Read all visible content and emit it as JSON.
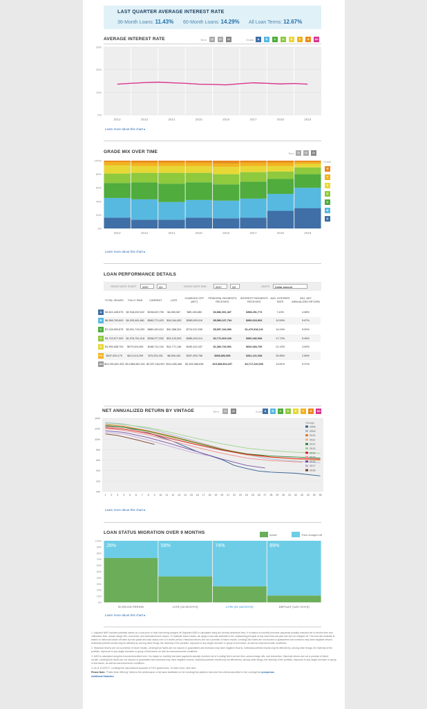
{
  "summary": {
    "title": "LAST QUARTER AVERAGE INTEREST RATE",
    "items": [
      {
        "label": "36-Month Loans:",
        "value": "11.43%"
      },
      {
        "label": "60-Month Loans:",
        "value": "14.29%"
      },
      {
        "label": "All Loan Terms:",
        "value": "12.67%"
      }
    ]
  },
  "links": {
    "learn_more": "Learn more about this chart ▸"
  },
  "controls": {
    "term_label": "Term",
    "grade_label": "Grade",
    "term_buttons": [
      "36",
      "60",
      "All"
    ],
    "term_buttons_short": [
      "36",
      "All"
    ]
  },
  "grades": [
    {
      "g": "A",
      "color": "#3f6fa6"
    },
    {
      "g": "B",
      "color": "#57b9e0"
    },
    {
      "g": "C",
      "color": "#4fac3d"
    },
    {
      "g": "D",
      "color": "#8fc93d"
    },
    {
      "g": "E",
      "color": "#e8d835"
    },
    {
      "g": "F",
      "color": "#f2b21f"
    },
    {
      "g": "G",
      "color": "#e88a1e"
    },
    {
      "g": "All",
      "color": "#d8358f"
    }
  ],
  "chart_data": [
    {
      "id": "avg_rate",
      "title": "AVERAGE INTEREST RATE",
      "type": "line",
      "x": [
        2012,
        2012.5,
        2013,
        2013.5,
        2014,
        2014.5,
        2015,
        2015.5,
        2016,
        2016.5,
        2017,
        2017.5,
        2018,
        2018.5,
        2019
      ],
      "y": [
        13.6,
        14.0,
        14.3,
        14.5,
        14.2,
        14.0,
        13.6,
        13.5,
        13.3,
        13.8,
        14.2,
        14.0,
        13.7,
        13.9,
        13.6
      ],
      "ylim": [
        0,
        30
      ],
      "yticks": [
        "0%",
        "10%",
        "20%",
        "30%"
      ],
      "xticks": [
        "2012",
        "2013",
        "2014",
        "2015",
        "2016",
        "2017",
        "2018",
        "2019"
      ],
      "color": "#d8358f"
    },
    {
      "id": "grade_mix",
      "title": "GRADE MIX OVER TIME",
      "type": "bar",
      "categories": [
        "2012",
        "2013",
        "2014",
        "2015",
        "2016",
        "2017",
        "2018",
        "2019"
      ],
      "yticks": [
        "0%",
        "20%",
        "40%",
        "60%",
        "80%",
        "100%"
      ],
      "stack_order": [
        "A",
        "B",
        "C",
        "D",
        "E",
        "F",
        "G"
      ],
      "values": [
        [
          16,
          13,
          13,
          16,
          15,
          16,
          26,
          30
        ],
        [
          29,
          30,
          26,
          26,
          26,
          28,
          25,
          30
        ],
        [
          22,
          25,
          27,
          26,
          24,
          25,
          22,
          20
        ],
        [
          14,
          14,
          16,
          14,
          15,
          14,
          11,
          10
        ],
        [
          12,
          10,
          10,
          10,
          11,
          9,
          8,
          5
        ],
        [
          5,
          5,
          5,
          5,
          5,
          5,
          5,
          3
        ],
        [
          2,
          3,
          3,
          3,
          4,
          3,
          3,
          2
        ]
      ]
    },
    {
      "id": "net_return",
      "title": "NET ANNUALIZED RETURN BY VINTAGE",
      "type": "line",
      "ylim": [
        0,
        14
      ],
      "yticks": [
        "0%",
        "2%",
        "4%",
        "6%",
        "8%",
        "10%",
        "12%",
        "14%"
      ],
      "xticks": [
        "1",
        "2",
        "3",
        "4",
        "5",
        "6",
        "7",
        "8",
        "9",
        "10",
        "11",
        "12",
        "13",
        "14",
        "15",
        "16",
        "17",
        "18",
        "19",
        "20",
        "21",
        "22",
        "23",
        "24",
        "25",
        "26",
        "27",
        "28",
        "29",
        "30",
        "31",
        "32",
        "33",
        "34",
        "35",
        "36"
      ],
      "legend_title": "Vintage",
      "series": [
        {
          "name": "2008",
          "color": "#2f5f8f",
          "points": [
            [
              1,
              12.5
            ],
            [
              4,
              12.3
            ],
            [
              8,
              11.2
            ],
            [
              12,
              9.6
            ],
            [
              16,
              7.6
            ],
            [
              20,
              6.1
            ],
            [
              22,
              5.0
            ],
            [
              24,
              4.4
            ],
            [
              26,
              3.9
            ],
            [
              28,
              3.7
            ],
            [
              32,
              3.5
            ],
            [
              36,
              3.0
            ]
          ]
        },
        {
          "name": "2009",
          "color": "#aab8d2",
          "points": [
            [
              1,
              13.2
            ],
            [
              4,
              12.9
            ],
            [
              8,
              12.0
            ],
            [
              12,
              10.8
            ],
            [
              16,
              9.5
            ],
            [
              20,
              8.2
            ],
            [
              24,
              7.0
            ],
            [
              28,
              6.2
            ],
            [
              32,
              5.8
            ],
            [
              36,
              5.5
            ]
          ]
        },
        {
          "name": "2010",
          "color": "#e8741e",
          "points": [
            [
              1,
              12.8
            ],
            [
              4,
              12.5
            ],
            [
              8,
              11.6
            ],
            [
              12,
              10.5
            ],
            [
              16,
              9.3
            ],
            [
              20,
              8.1
            ],
            [
              24,
              7.2
            ],
            [
              28,
              6.6
            ],
            [
              32,
              6.2
            ],
            [
              36,
              6.0
            ]
          ]
        },
        {
          "name": "2011",
          "color": "#f4b183",
          "points": [
            [
              1,
              12.4
            ],
            [
              4,
              12.1
            ],
            [
              8,
              11.3
            ],
            [
              12,
              10.2
            ],
            [
              16,
              9.0
            ],
            [
              20,
              7.9
            ],
            [
              24,
              7.0
            ],
            [
              28,
              6.5
            ],
            [
              32,
              6.2
            ],
            [
              36,
              6.1
            ]
          ]
        },
        {
          "name": "2012",
          "color": "#2e8b2e",
          "points": [
            [
              1,
              12.6
            ],
            [
              4,
              12.3
            ],
            [
              8,
              11.5
            ],
            [
              12,
              10.4
            ],
            [
              16,
              9.2
            ],
            [
              20,
              8.0
            ],
            [
              24,
              7.2
            ],
            [
              28,
              6.8
            ],
            [
              32,
              6.6
            ],
            [
              36,
              6.4
            ]
          ]
        },
        {
          "name": "2013",
          "color": "#9bd48a",
          "points": [
            [
              1,
              13.0
            ],
            [
              4,
              12.8
            ],
            [
              8,
              12.2
            ],
            [
              12,
              11.2
            ],
            [
              16,
              10.1
            ],
            [
              20,
              9.1
            ],
            [
              24,
              8.3
            ],
            [
              28,
              7.8
            ],
            [
              32,
              7.5
            ],
            [
              36,
              7.3
            ]
          ]
        },
        {
          "name": "2014",
          "color": "#d8222a",
          "points": [
            [
              1,
              12.2
            ],
            [
              4,
              11.9
            ],
            [
              8,
              11.1
            ],
            [
              12,
              10.0
            ],
            [
              16,
              8.9
            ],
            [
              20,
              7.9
            ],
            [
              24,
              7.1
            ],
            [
              28,
              6.6
            ],
            [
              32,
              6.3
            ],
            [
              36,
              6.2
            ]
          ]
        },
        {
          "name": "2015",
          "color": "#f28b8b",
          "points": [
            [
              1,
              12.0
            ],
            [
              4,
              11.7
            ],
            [
              8,
              10.8
            ],
            [
              12,
              9.6
            ],
            [
              16,
              8.4
            ],
            [
              20,
              7.3
            ],
            [
              24,
              6.4
            ],
            [
              28,
              5.9
            ],
            [
              33,
              5.6
            ]
          ]
        },
        {
          "name": "2016",
          "color": "#7a4fa8",
          "points": [
            [
              1,
              11.6
            ],
            [
              4,
              11.3
            ],
            [
              8,
              10.3
            ],
            [
              12,
              9.0
            ],
            [
              16,
              7.6
            ],
            [
              20,
              6.2
            ],
            [
              24,
              5.0
            ],
            [
              27,
              4.5
            ]
          ]
        },
        {
          "name": "2017",
          "color": "#c3a8d8",
          "points": [
            [
              1,
              11.3
            ],
            [
              4,
              11.0
            ],
            [
              8,
              9.8
            ],
            [
              12,
              8.5
            ],
            [
              15,
              7.5
            ],
            [
              18,
              6.8
            ]
          ]
        },
        {
          "name": "2018",
          "color": "#7a3b23",
          "points": [
            [
              1,
              11.0
            ],
            [
              3,
              10.7
            ],
            [
              6,
              9.9
            ],
            [
              9,
              9.0
            ]
          ]
        }
      ]
    },
    {
      "id": "status_migration",
      "title": "LOAN STATUS MIGRATION OVER 9 MONTHS",
      "type": "bar",
      "categories": [
        "IN GRACE PERIOD",
        "LATE (16-30 DAYS)",
        "LATE (31-120 DAYS)",
        "DEFAULT (120+ DAYS)"
      ],
      "yticks": [
        "0%",
        "10%",
        "20%",
        "30%",
        "40%",
        "50%",
        "60%",
        "70%",
        "80%",
        "90%",
        "100%"
      ],
      "series": [
        {
          "name": "Active",
          "color": "#6cad5a",
          "values": [
            72,
            42,
            26,
            11
          ]
        },
        {
          "name": "Then charged off",
          "color": "#6dcde6",
          "values": [
            28,
            58,
            74,
            89
          ]
        }
      ],
      "labels": [
        "28%",
        "58%",
        "74%",
        "89%"
      ]
    }
  ],
  "perf": {
    "title": "LOAN PERFORMANCE DETAILS",
    "filters": {
      "start_label": "ISSUE DATE START",
      "start_year": "2007",
      "start_q": "Q1",
      "end_label": "ISSUE DATE END",
      "end_year": "2017",
      "end_q": "Q2",
      "units_label": "UNITS",
      "units": "Dollar amount"
    },
    "headers": [
      "",
      "TOTAL ISSUED",
      "FULLY PAID",
      "CURRENT",
      "LATE",
      "CHARGED OFF (NET)",
      "PRINCIPAL PAYMENTS RECEIVED",
      "INTEREST PAYMENTS RECEIVED",
      "AVG. INTEREST RATE",
      "ADJ. NET ANNUALIZED RETURN"
    ],
    "rows": [
      [
        "A",
        "$3,624,185,575",
        "$2,918,492,922",
        "$238,629,759",
        "$4,069,367",
        "$89,135,880",
        "$3,580,391,367",
        "$358,251,773",
        "7.10%",
        "4.58%"
      ],
      [
        "B",
        "$6,558,763,600",
        "$4,293,461,861",
        "$583,771,623",
        "$18,164,453",
        "$365,699,116",
        "$5,589,137,794",
        "$969,010,563",
        "10.59%",
        "5.67%"
      ],
      [
        "C",
        "$7,218,893,875",
        "$3,991,716,093",
        "$882,440,612",
        "$42,388,324",
        "$724,912,935",
        "$5,557,154,966",
        "$1,470,918,131",
        "14.04%",
        "5.92%"
      ],
      [
        "D",
        "$3,719,577,000",
        "$1,976,751,218",
        "$338,377,532",
        "$23,120,093",
        "$585,493,214",
        "$2,772,609,160",
        "$960,282,908",
        "17.73%",
        "5.45%"
      ],
      [
        "E",
        "$1,995,638,700",
        "$979,024,349",
        "$168,711,134",
        "$14,771,136",
        "$430,422,437",
        "$1,383,733,991",
        "$626,684,759",
        "21.15%",
        "4.90%"
      ],
      [
        "FG",
        "$937,533,175",
        "$413,115,299",
        "$75,225,331",
        "$8,906,183",
        "$267,459,756",
        "$585,896,985",
        "$331,221,938",
        "25.86%",
        "2.89%"
      ],
      [
        "All",
        "$24,250,691,325",
        "$14,565,562,341",
        "$2,287,164,991",
        "$111,456,466",
        "$2,463,086,638",
        "$19,388,804,297",
        "$4,717,220,695",
        "13.61%",
        "5.37%"
      ]
    ]
  },
  "migration_legend": [
    "Active",
    "Then charged off"
  ],
  "footnotes": [
    "1. Adjusted NAR includes potential losses on a loan prior to final loan being charged off. Adjusted NAR is calculated using the formula described here. It is based on monthly borrower payments actually received net of service fees and collections fees, actual charge offs, recoveries, and estimated future losses. To estimate future losses, we apply a loss rate estimate to the outstanding principal of any loans that are past due but not charged off. The loss rate estimate is based on historical losses off rates by loan grade and loan status over a 9-month period. Historical returns are not a promise of future results. LendingClub Notes are not insured or guaranteed and investors may have negative returns. Individual portfolio results may be affected by, among other things, the diversity of the portfolio, exposure to any single borrower or group of borrowers, as well as macroeconomic conditions.",
    "2. Historical returns are not a promise of future results. LendingClub Notes are not insured or guaranteed and investors may have negative returns. Individual portfolio results may be affected by, among other things, the diversity of the portfolio, exposure to any single borrower or group of borrowers, as well as macroeconomic conditions.",
    "3. NAR is calculated using the formula described here. It is based on monthly borrower payments actually received net of LendingClub's service fees, actual charge offs, and recoveries. Historical returns are not a promise of future results. LendingClub Notes are not insured or guaranteed and investors may have negative returns. Individual portfolio results may be affected by, among other things, the diversity of the portfolio, exposure to any single borrower or group of borrowers, as well as macroeconomic conditions.",
    "4. As of 11/2/2017, LendingClub discontinued issuance of F&G grade loans. To learn more, click here."
  ],
  "foot_last": {
    "bold": "Please Note:",
    "text": "“Public Note Offering” refers to the performance of all loans facilitated on the LendingClub platform that meet the criteria described in the LendingClub",
    "link1": "prospectus",
    "link2": "Additional Statistics"
  }
}
